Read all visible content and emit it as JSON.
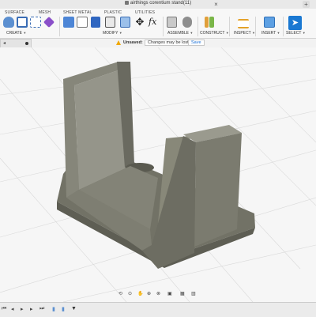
{
  "window": {
    "title": "airthings corentium stand(11)",
    "add_tab": "+"
  },
  "ribbon": {
    "tabs": [
      "SURFACE",
      "MESH",
      "SHEET METAL",
      "PLASTIC",
      "UTILITIES"
    ],
    "groups": [
      "CREATE",
      "MODIFY",
      "ASSEMBLE",
      "CONSTRUCT",
      "INSPECT",
      "INSERT",
      "SELECT"
    ],
    "fx_label": "fx"
  },
  "notice": {
    "status": "Unsaved:",
    "message": "Changes may be lost",
    "save_label": "Save"
  },
  "colors": {
    "accent": "#1a6fd6",
    "model": "#707064",
    "ground_grid": "#d8d8d8"
  },
  "icons": [
    "lock-icon",
    "close-icon",
    "add-tab-icon",
    "warning-icon",
    "orbit-icon",
    "pan-icon",
    "zoom-icon",
    "display-icon",
    "grid-icon",
    "play-icon",
    "step-back-icon",
    "step-forward-icon",
    "end-icon"
  ]
}
